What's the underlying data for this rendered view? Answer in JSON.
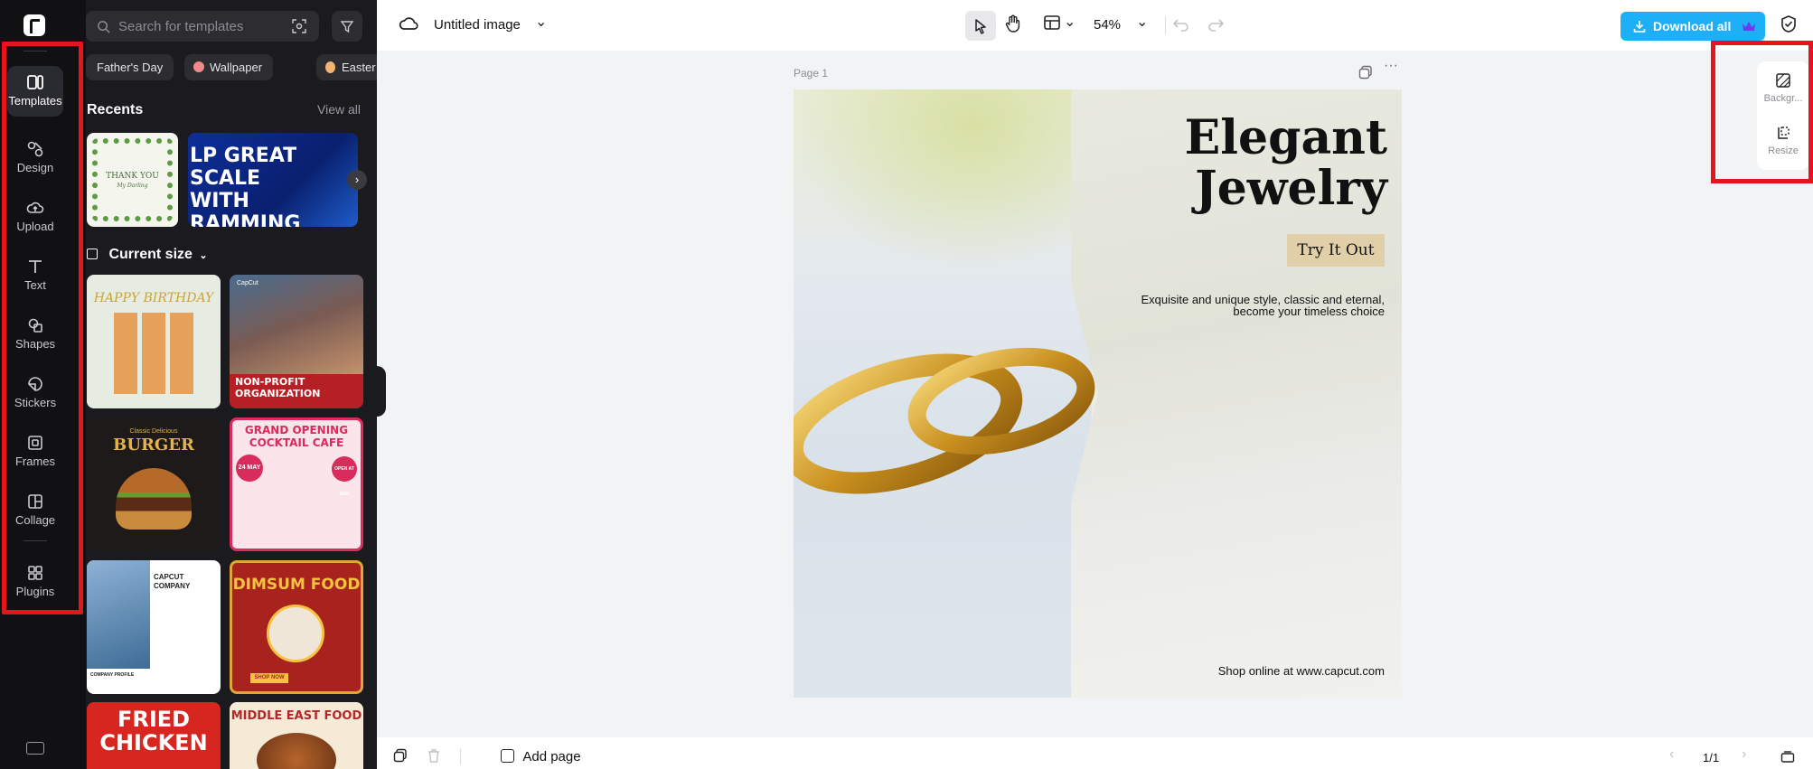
{
  "rail": {
    "items": [
      {
        "label": "Templates",
        "icon": "templates-icon"
      },
      {
        "label": "Design",
        "icon": "design-icon"
      },
      {
        "label": "Upload",
        "icon": "upload-icon"
      },
      {
        "label": "Text",
        "icon": "text-icon"
      },
      {
        "label": "Shapes",
        "icon": "shapes-icon"
      },
      {
        "label": "Stickers",
        "icon": "stickers-icon"
      },
      {
        "label": "Frames",
        "icon": "frames-icon"
      },
      {
        "label": "Collage",
        "icon": "collage-icon"
      },
      {
        "label": "Plugins",
        "icon": "plugins-icon"
      }
    ],
    "active": "Templates"
  },
  "panel": {
    "search_placeholder": "Search for templates",
    "chips": [
      "Father's Day",
      "Wallpaper",
      "Easter"
    ],
    "recents_title": "Recents",
    "view_all": "View all",
    "current_size": "Current size",
    "recent_thumbs": [
      {
        "text1": "THANK YOU",
        "text2": "My Darling"
      },
      {
        "text": "LP GREAT SCALE WITH RAMMING"
      }
    ],
    "templates": [
      {
        "title": "HAPPY BIRTHDAY"
      },
      {
        "title": "NON-PROFIT ORGANIZATION",
        "brand": "CapCut"
      },
      {
        "title": "BURGER",
        "subtitle": "Classic Delicious"
      },
      {
        "title": "GRAND OPENING COCKTAIL CAFE",
        "badge": "24 MAY",
        "badge2": "OPEN AT 8AM"
      },
      {
        "title": "CAPCUT COMPANY",
        "subtitle": "COMPANY PROFILE"
      },
      {
        "title": "DIMSUM FOOD",
        "button": "SHOP NOW"
      },
      {
        "title": "FRIED CHICKEN"
      },
      {
        "title": "MIDDLE EAST FOOD"
      }
    ]
  },
  "topbar": {
    "doc_title": "Untitled image",
    "zoom": "54%",
    "download": "Download all"
  },
  "canvas": {
    "page_label": "Page 1",
    "title": "Elegant Jewelry",
    "title_line1": "Elegant",
    "title_line2": "Jewelry",
    "cta": "Try It Out",
    "tagline_line1": "Exquisite and unique style, classic and eternal,",
    "tagline_line2": "become your timeless choice",
    "shop": "Shop online at www.capcut.com"
  },
  "right_panel": {
    "background": "Backgr...",
    "resize": "Resize"
  },
  "bottombar": {
    "add_page": "Add page",
    "page_count": "1/1"
  },
  "colors": {
    "accent": "#1eb0f6",
    "highlight": "#e8141b",
    "panel_bg": "#1b1b1f"
  }
}
